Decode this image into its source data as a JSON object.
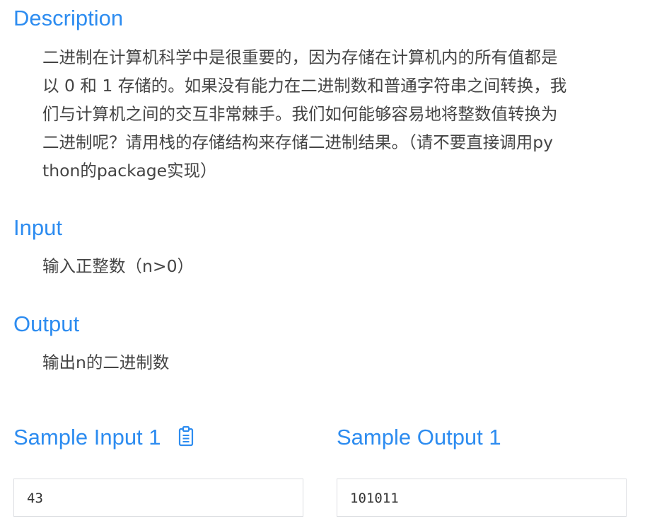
{
  "description": {
    "heading": "Description",
    "lines": [
      "二进制在计算机科学中是很重要的，因为存储在计算机内的所有值都是",
      "以 0 和 1 存储的。如果没有能力在二进制数和普通字符串之间转换，我",
      "们与计算机之间的交互非常棘手。我们如何能够容易地将整数值转换为",
      "二进制呢？请用栈的存储结构来存储二进制结果。（请不要直接调用py",
      "thon的package实现）"
    ]
  },
  "input": {
    "heading": "Input",
    "text": "输入正整数（n>0）"
  },
  "output": {
    "heading": "Output",
    "text": "输出n的二进制数"
  },
  "sample_input": {
    "heading": "Sample Input 1",
    "value": "43",
    "icon": "clipboard-icon"
  },
  "sample_output": {
    "heading": "Sample Output 1",
    "value": "101011"
  },
  "colors": {
    "heading": "#2d8cf0",
    "text": "#444444",
    "box_border": "#dcdee2"
  }
}
